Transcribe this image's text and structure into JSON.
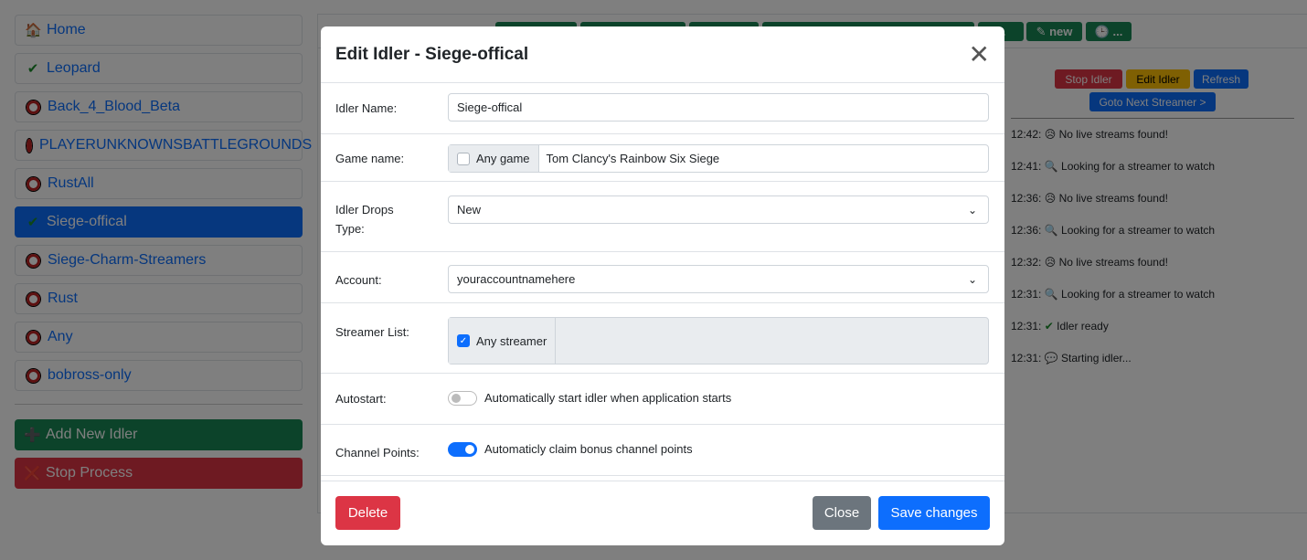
{
  "sidebar": {
    "items": [
      {
        "label": "Home",
        "icon": "house-icon"
      },
      {
        "label": "Leopard",
        "icon": "check-icon"
      },
      {
        "label": "Back_4_Blood_Beta",
        "icon": "stop-ring-icon"
      },
      {
        "label": "PLAYERUNKNOWNSBATTLEGROUNDS",
        "icon": "stop-ring-icon"
      },
      {
        "label": "RustAll",
        "icon": "stop-ring-icon"
      },
      {
        "label": "Siege-offical",
        "icon": "check-icon",
        "active": true
      },
      {
        "label": "Siege-Charm-Streamers",
        "icon": "stop-ring-icon"
      },
      {
        "label": "Rust",
        "icon": "stop-ring-icon"
      },
      {
        "label": "Any",
        "icon": "stop-ring-icon"
      },
      {
        "label": "bobross-only",
        "icon": "stop-ring-icon"
      }
    ],
    "add_label": "Add New Idler",
    "stop_label": "Stop Process"
  },
  "topbar": {
    "btn5": "...",
    "btn6": "new",
    "btn7": "..."
  },
  "panel": {
    "stop": "Stop Idler",
    "edit": "Edit Idler",
    "refresh": "Refresh",
    "next": "Goto Next Streamer >",
    "log": [
      {
        "time": "12:42:",
        "icon": "sad-face-icon",
        "text": "No live streams found!"
      },
      {
        "time": "12:41:",
        "icon": "magnifier-icon",
        "text": "Looking for a streamer to watch"
      },
      {
        "time": "12:36:",
        "icon": "sad-face-icon",
        "text": "No live streams found!"
      },
      {
        "time": "12:36:",
        "icon": "magnifier-icon",
        "text": "Looking for a streamer to watch"
      },
      {
        "time": "12:32:",
        "icon": "sad-face-icon",
        "text": "No live streams found!"
      },
      {
        "time": "12:31:",
        "icon": "magnifier-icon",
        "text": "Looking for a streamer to watch"
      },
      {
        "time": "12:31:",
        "icon": "check-icon",
        "text": "Idler ready"
      },
      {
        "time": "12:31:",
        "icon": "speech-bubble-icon",
        "text": "Starting idler..."
      }
    ]
  },
  "modal": {
    "title": "Edit Idler - Siege-offical",
    "name_label": "Idler Name:",
    "name_value": "Siege-offical",
    "game_label": "Game name:",
    "any_game": "Any game",
    "any_game_checked": false,
    "game_value": "Tom Clancy's Rainbow Six Siege",
    "drops_label": "Idler Drops Type:",
    "drops_value": "New",
    "account_label": "Account:",
    "account_value": "youraccountnamehere",
    "streamer_label": "Streamer List:",
    "any_streamer": "Any streamer",
    "any_streamer_checked": true,
    "autostart_label": "Autostart:",
    "autostart_text": "Automatically start idler when application starts",
    "autostart_on": false,
    "points_label": "Channel Points:",
    "points_text": "Automaticly claim bonus channel points",
    "points_on": true,
    "delete": "Delete",
    "close": "Close",
    "save": "Save changes"
  }
}
